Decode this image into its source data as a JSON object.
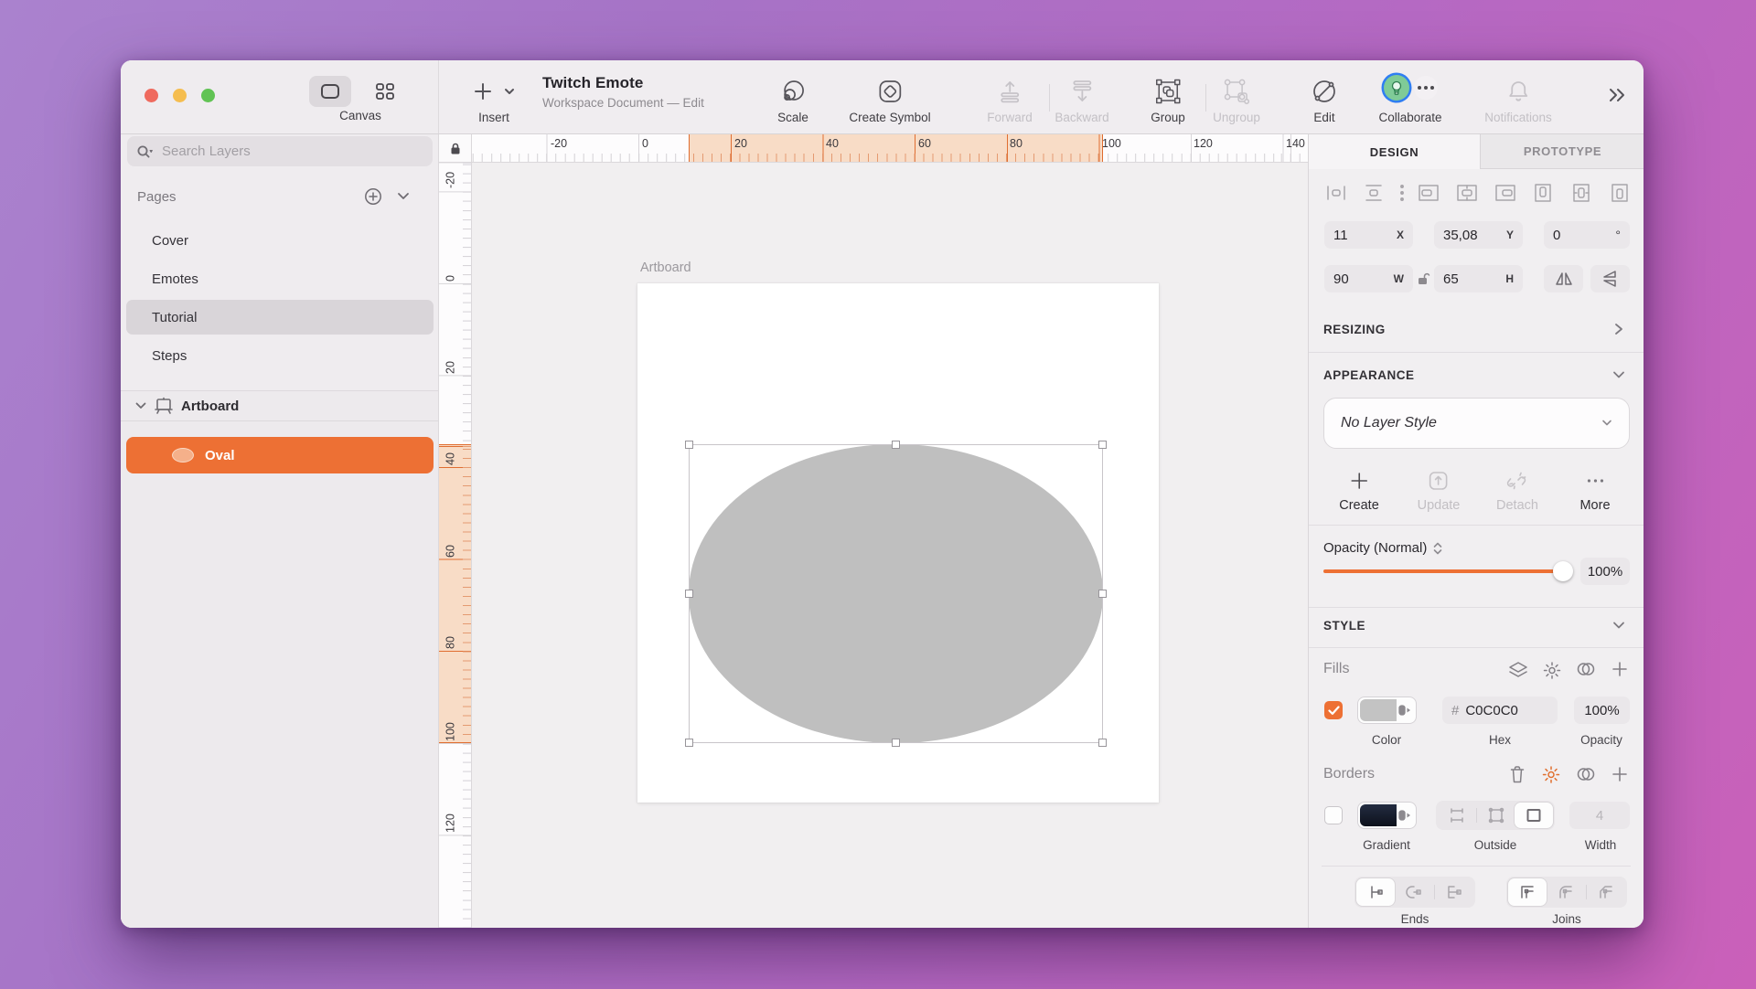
{
  "titlebar": {
    "canvas_label": "Canvas"
  },
  "toolbar": {
    "insert": "Insert",
    "title": "Twitch Emote",
    "subtitle": "Workspace Document — Edit",
    "scale": "Scale",
    "create_symbol": "Create Symbol",
    "forward": "Forward",
    "backward": "Backward",
    "group": "Group",
    "ungroup": "Ungroup",
    "edit": "Edit",
    "collaborate": "Collaborate",
    "notifications": "Notifications"
  },
  "sidebar": {
    "search_placeholder": "Search Layers",
    "pages_label": "Pages",
    "pages": [
      "Cover",
      "Emotes",
      "Tutorial",
      "Steps"
    ],
    "selected_page": "Tutorial",
    "artboard_label": "Artboard",
    "oval_label": "Oval"
  },
  "rulers": {
    "h": [
      "-20",
      "0",
      "20",
      "40",
      "60",
      "80",
      "100",
      "120",
      "140"
    ],
    "v": [
      "-20",
      "0",
      "20",
      "40",
      "60",
      "80",
      "100",
      "120"
    ]
  },
  "canvas": {
    "artboard_label": "Artboard"
  },
  "inspector": {
    "tabs": {
      "design": "DESIGN",
      "prototype": "PROTOTYPE"
    },
    "position": {
      "x": "11",
      "x_unit": "X",
      "y": "35,08",
      "y_unit": "Y",
      "rotation": "0",
      "rotation_unit": "°",
      "w": "90",
      "w_unit": "W",
      "h": "65",
      "h_unit": "H"
    },
    "resizing_label": "RESIZING",
    "appearance": {
      "label": "APPEARANCE",
      "layer_style": "No Layer Style",
      "create": "Create",
      "update": "Update",
      "detach": "Detach",
      "more": "More"
    },
    "opacity": {
      "label": "Opacity (Normal)",
      "value": "100%"
    },
    "style_label": "STYLE",
    "fills": {
      "label": "Fills",
      "hex_prefix": "#",
      "hex": "C0C0C0",
      "opacity": "100%",
      "color_label": "Color",
      "hex_label": "Hex",
      "opacity_label": "Opacity"
    },
    "borders": {
      "label": "Borders",
      "width": "4",
      "gradient_label": "Gradient",
      "position_label": "Outside",
      "width_label": "Width"
    },
    "caps": {
      "ends_label": "Ends",
      "joins_label": "Joins"
    }
  },
  "colors": {
    "accent": "#ED7034",
    "fill_hex": "#C0C0C0",
    "collaborate_ring": "#2F7EF2"
  }
}
